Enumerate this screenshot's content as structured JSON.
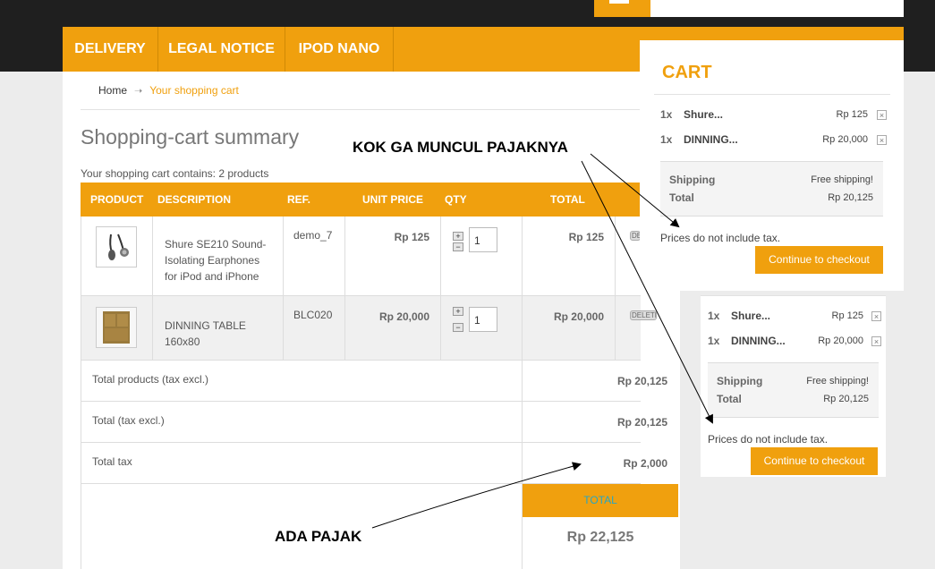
{
  "nav": {
    "items": [
      "DELIVERY",
      "LEGAL NOTICE",
      "IPOD NANO"
    ]
  },
  "breadcrumb": {
    "home": "Home",
    "separator": "➝",
    "current": "Your shopping cart"
  },
  "page_title": "Shopping-cart summary",
  "cart_count_text": "Your shopping cart contains: 2 products",
  "table": {
    "headers": [
      "PRODUCT",
      "DESCRIPTION",
      "REF.",
      "UNIT PRICE",
      "QTY",
      "TOTAL"
    ],
    "rows": [
      {
        "description": "Shure SE210 Sound-Isolating Earphones for iPod and iPhone",
        "ref": "demo_7",
        "unit_price": "Rp 125",
        "qty": "1",
        "total": "Rp 125",
        "delete": "DELETE"
      },
      {
        "description": "DINNING TABLE 160x80",
        "ref": "BLC020",
        "unit_price": "Rp 20,000",
        "qty": "1",
        "total": "Rp 20,000",
        "delete": "DELETE"
      }
    ],
    "qty_plus": "+",
    "qty_minus": "−",
    "summary": [
      {
        "label": "Total products (tax excl.)",
        "value": "Rp 20,125"
      },
      {
        "label": "Total (tax excl.)",
        "value": "Rp 20,125"
      },
      {
        "label": "Total tax",
        "value": "Rp 2,000"
      }
    ],
    "total_label": "TOTAL",
    "total_value": "Rp 22,125"
  },
  "cart_block": {
    "title": "CART",
    "items": [
      {
        "qty": "1x",
        "name": "Shure...",
        "price": "Rp 125"
      },
      {
        "qty": "1x",
        "name": "DINNING...",
        "price": "Rp 20,000"
      }
    ],
    "remove_symbol": "×",
    "shipping_label": "Shipping",
    "shipping_value": "Free shipping!",
    "total_label": "Total",
    "total_value": "Rp 20,125",
    "tax_note": "Prices do not include tax.",
    "checkout_label": "Continue to checkout"
  },
  "annotations": {
    "top": "KOK GA MUNCUL PAJAKNYA",
    "bottom": "ADA PAJAK"
  },
  "colors": {
    "accent": "#f0a00e",
    "dark_bar": "#1f1f1f",
    "total_label": "#27a6c4"
  }
}
